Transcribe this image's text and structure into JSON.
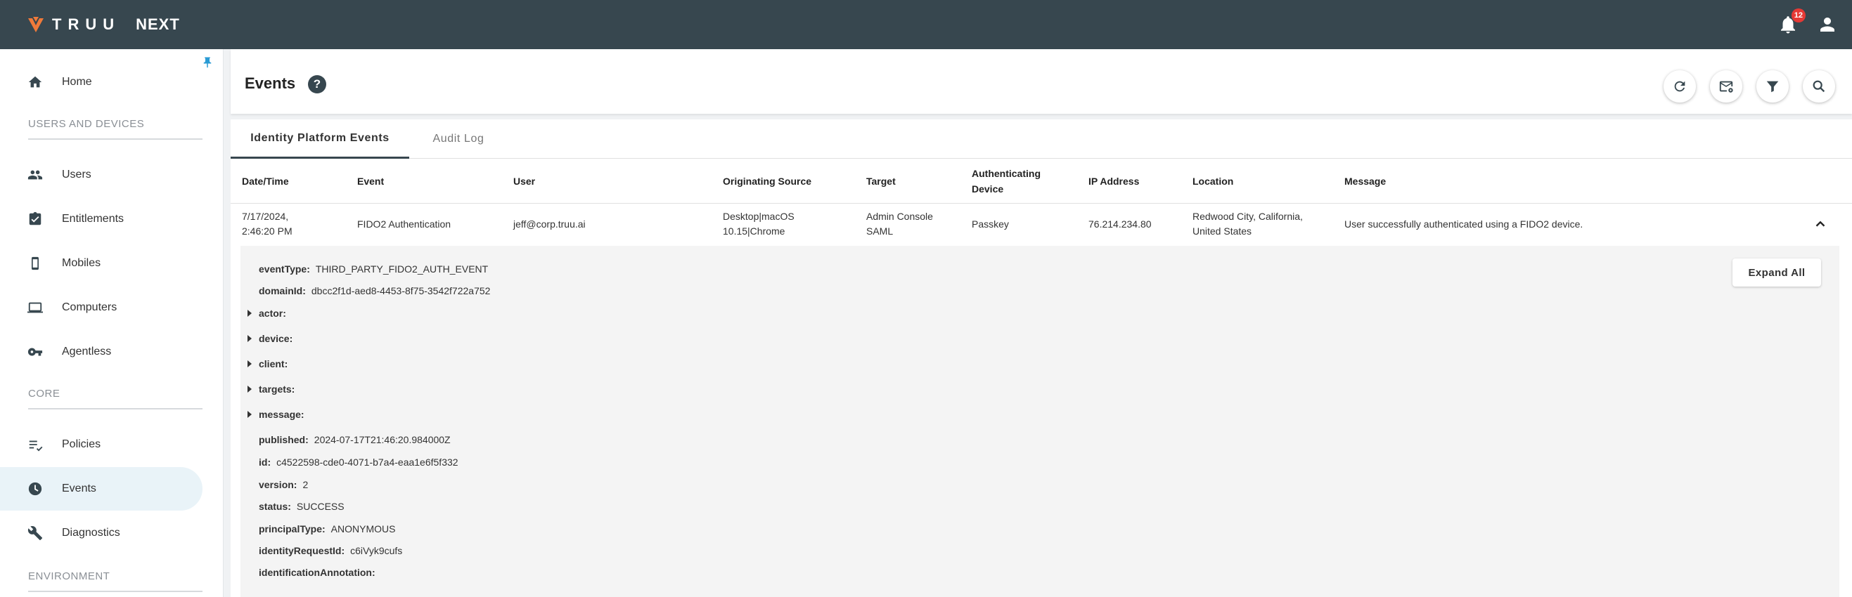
{
  "app": {
    "brand": "TRUU",
    "product": "NEXT",
    "notification_count": "12",
    "colors": {
      "topbar": "#37474f",
      "accent": "#f07a3a",
      "active_nav": "#e9f3f8",
      "badge": "#e53935"
    }
  },
  "sidebar": {
    "home": "Home",
    "section_users": "USERS AND DEVICES",
    "users": "Users",
    "entitlements": "Entitlements",
    "mobiles": "Mobiles",
    "computers": "Computers",
    "agentless": "Agentless",
    "section_core": "CORE",
    "policies": "Policies",
    "events": "Events",
    "diagnostics": "Diagnostics",
    "section_environment": "ENVIRONMENT",
    "active_item": "Events"
  },
  "header": {
    "title": "Events",
    "help": "?",
    "icons": [
      "refresh-icon",
      "email-settings-icon",
      "filter-icon",
      "search-icon"
    ]
  },
  "tabs": [
    {
      "label": "Identity Platform Events",
      "active": true
    },
    {
      "label": "Audit Log",
      "active": false
    }
  ],
  "table": {
    "columns": {
      "datetime": "Date/Time",
      "event": "Event",
      "user": "User",
      "source": "Originating Source",
      "target": "Target",
      "auth_device_1": "Authenticating",
      "auth_device_2": "Device",
      "ip": "IP Address",
      "location": "Location",
      "message": "Message"
    },
    "row": {
      "datetime_1": "7/17/2024,",
      "datetime_2": "2:46:20 PM",
      "event": "FIDO2 Authentication",
      "user": "jeff@corp.truu.ai",
      "source_1": "Desktop|macOS",
      "source_2": "10.15|Chrome",
      "target_1": "Admin Console",
      "target_2": "SAML",
      "auth_device": "Passkey",
      "ip": "76.214.234.80",
      "location_1": "Redwood City, California,",
      "location_2": "United States",
      "message": "User successfully authenticated using a FIDO2 device."
    }
  },
  "detail": {
    "expand_all": "Expand All",
    "event_type_key": "eventType:",
    "event_type_val": "THIRD_PARTY_FIDO2_AUTH_EVENT",
    "domain_id_key": "domainId:",
    "domain_id_val": "dbcc2f1d-aed8-4453-8f75-3542f722a752",
    "actor_key": "actor:",
    "device_key": "device:",
    "client_key": "client:",
    "targets_key": "targets:",
    "message_key": "message:",
    "published_key": "published:",
    "published_val": "2024-07-17T21:46:20.984000Z",
    "id_key": "id:",
    "id_val": "c4522598-cde0-4071-b7a4-eaa1e6f5f332",
    "version_key": "version:",
    "version_val": "2",
    "status_key": "status:",
    "status_val": "SUCCESS",
    "principal_key": "principalType:",
    "principal_val": "ANONYMOUS",
    "identity_req_key": "identityRequestId:",
    "identity_req_val": "c6iVyk9cufs",
    "annotation_key": "identificationAnnotation:"
  }
}
